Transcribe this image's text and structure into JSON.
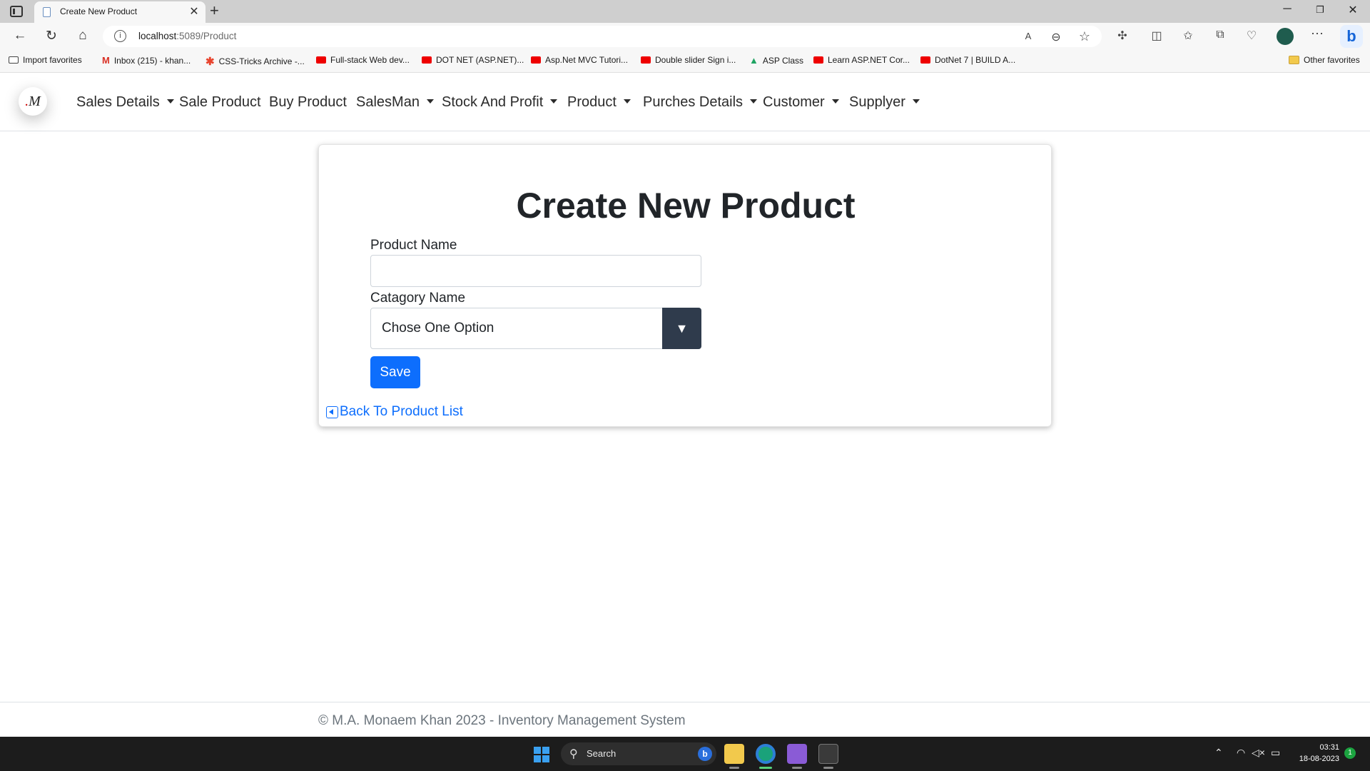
{
  "browser": {
    "tab_title": "Create New Product",
    "url_host": "localhost",
    "url_path": ":5089/Product",
    "favorites": [
      {
        "label": "Import favorites",
        "icon": "import-icon"
      },
      {
        "label": "Inbox (215) - khan...",
        "icon": "gmail-icon"
      },
      {
        "label": "CSS-Tricks Archive -...",
        "icon": "css-tricks-icon"
      },
      {
        "label": "Full-stack Web dev...",
        "icon": "youtube-icon"
      },
      {
        "label": "DOT NET (ASP.NET)...",
        "icon": "youtube-icon"
      },
      {
        "label": "Asp.Net MVC Tutori...",
        "icon": "youtube-icon"
      },
      {
        "label": "Double slider Sign i...",
        "icon": "youtube-icon"
      },
      {
        "label": "ASP Class",
        "icon": "google-drive-icon"
      },
      {
        "label": "Learn ASP.NET Cor...",
        "icon": "youtube-icon"
      },
      {
        "label": "DotNet 7 | BUILD A...",
        "icon": "youtube-icon"
      }
    ],
    "other_favorites": "Other favorites"
  },
  "nav": {
    "logo_text": "M",
    "items": [
      {
        "label": "Sales Details",
        "dropdown": true
      },
      {
        "label": "Sale Product",
        "dropdown": false
      },
      {
        "label": "Buy Product",
        "dropdown": false
      },
      {
        "label": "SalesMan",
        "dropdown": true
      },
      {
        "label": "Stock And Profit",
        "dropdown": true
      },
      {
        "label": "Product",
        "dropdown": true
      },
      {
        "label": "Purches Details",
        "dropdown": true
      },
      {
        "label": "Customer",
        "dropdown": true
      },
      {
        "label": "Supplyer",
        "dropdown": true
      }
    ]
  },
  "form": {
    "title": "Create New Product",
    "product_name_label": "Product Name",
    "product_name_value": "",
    "category_label": "Catagory Name",
    "category_value": "Chose One Option",
    "save_label": "Save",
    "back_label": "Back To Product List"
  },
  "footer": {
    "text": "© M.A. Monaem Khan 2023 - Inventory Management System"
  },
  "taskbar": {
    "search_placeholder": "Search",
    "time": "03:31",
    "date": "18-08-2023",
    "notification_count": "1"
  },
  "colors": {
    "primary": "#0d6efd",
    "select_arrow_bg": "#2f3b4c",
    "footer_text": "#6c757d"
  }
}
